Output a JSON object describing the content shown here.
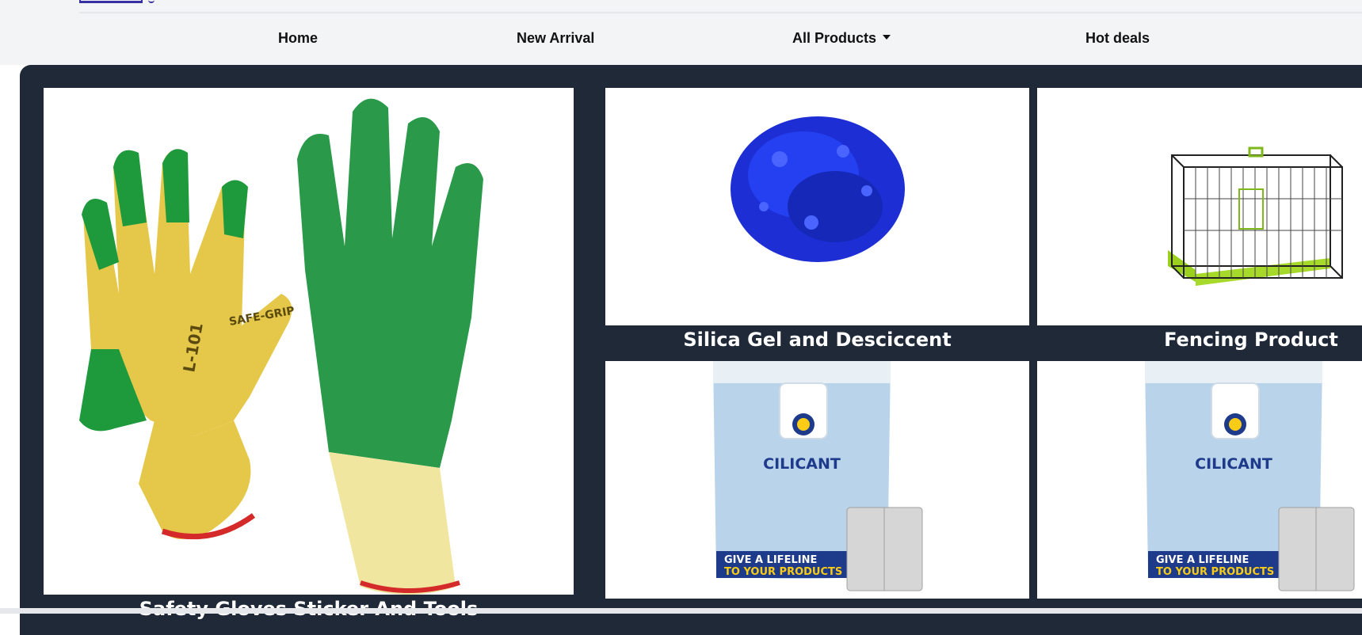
{
  "nav": {
    "items": [
      {
        "label": "Home"
      },
      {
        "label": "New Arrival"
      },
      {
        "label": "All Products"
      },
      {
        "label": "Hot deals"
      }
    ]
  },
  "products": {
    "gloves": {
      "title": "Safety Gloves Sticker And Tools",
      "image": "gloves-image"
    },
    "silica": {
      "title": "Silica Gel and Desciccent",
      "image": "silica-gel-image"
    },
    "fencing": {
      "title": "Fencing Product",
      "image": "cage-image"
    },
    "pack1": {
      "brand": "CILICANT",
      "tagline_1": "GIVE A LIFELINE",
      "tagline_2": "TO YOUR PRODUCTS"
    },
    "pack2": {
      "brand": "CILICANT",
      "tagline_1": "GIVE A LIFELINE",
      "tagline_2": "TO YOUR PRODUCTS"
    }
  },
  "colors": {
    "panel": "#1f2937",
    "topbar": "#f3f4f6",
    "accent": "#3730a3"
  }
}
